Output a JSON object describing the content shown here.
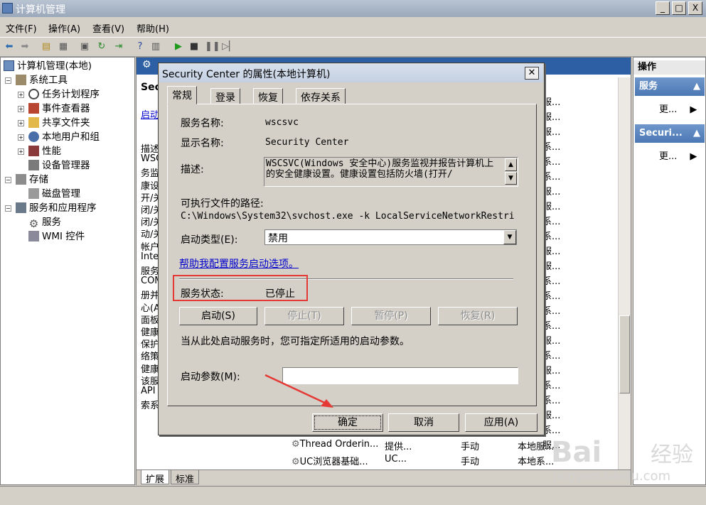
{
  "window": {
    "title": "计算机管理",
    "controls": {
      "minimize": "_",
      "maximize": "□",
      "close": "X"
    }
  },
  "menu": {
    "items": [
      "文件(F)",
      "操作(A)",
      "查看(V)",
      "帮助(H)"
    ]
  },
  "tree": {
    "root": "计算机管理(本地)",
    "items": [
      {
        "label": "系统工具",
        "icon": "tools-icon",
        "expander": "⊟"
      },
      {
        "label": "任务计划程序",
        "icon": "clock-icon",
        "expander": "⊞"
      },
      {
        "label": "事件查看器",
        "icon": "event-viewer-icon",
        "expander": "⊞"
      },
      {
        "label": "共享文件夹",
        "icon": "shared-folder-icon",
        "expander": "⊞"
      },
      {
        "label": "本地用户和组",
        "icon": "users-icon",
        "expander": "⊞"
      },
      {
        "label": "性能",
        "icon": "performance-icon",
        "expander": "⊞"
      },
      {
        "label": "设备管理器",
        "icon": "device-manager-icon",
        "expander": ""
      },
      {
        "label": "存储",
        "icon": "storage-icon",
        "expander": "⊟"
      },
      {
        "label": "磁盘管理",
        "icon": "disk-icon",
        "expander": ""
      },
      {
        "label": "服务和应用程序",
        "icon": "services-apps-icon",
        "expander": "⊟"
      },
      {
        "label": "服务",
        "icon": "gear-icon",
        "expander": ""
      },
      {
        "label": "WMI 控件",
        "icon": "wmi-icon",
        "expander": ""
      }
    ]
  },
  "middle": {
    "title_fragment": "Sec",
    "link_fragment": "启动",
    "desc_fragments": [
      "描述",
      "WSC",
      "务监",
      "康设",
      "开/关",
      "闭/关",
      "闭/关",
      "动/关",
      "帐户",
      "Inte",
      "服务",
      "COM",
      "册并",
      "心(A",
      "面板",
      "健康",
      "保护",
      "络策",
      "健康",
      "该服",
      "API",
      "索系"
    ],
    "rows": [
      {
        "name": "Thread Orderin...",
        "desc": "提供...",
        "startup": "手动",
        "logon": "本地服..."
      },
      {
        "name": "UC浏览器基础...",
        "desc": "UC...",
        "startup": "手动",
        "logon": "本地系..."
      }
    ],
    "right_fragments": [
      "服...",
      "服...",
      "服...",
      "系...",
      "系...",
      "系...",
      "服...",
      "服...",
      "系...",
      "系...",
      "服...",
      "服...",
      "系...",
      "系...",
      "系...",
      "系...",
      "服...",
      "系...",
      "服...",
      "系...",
      "系...",
      "服...",
      "系...",
      "服..."
    ],
    "bottom_tabs": [
      "扩展",
      "标准"
    ]
  },
  "actions": {
    "header": "操作",
    "group1": "服务",
    "group1_more": "更...",
    "group2": "Securi...",
    "group2_more": "更..."
  },
  "dialog": {
    "title": "Security Center 的属性(本地计算机)",
    "tabs": [
      "常规",
      "登录",
      "恢复",
      "依存关系"
    ],
    "service_name_label": "服务名称:",
    "service_name": "wscsvc",
    "display_name_label": "显示名称:",
    "display_name": "Security Center",
    "description_label": "描述:",
    "description": "WSCSVC(Windows 安全中心)服务监视并报告计算机上的安全健康设置。健康设置包括防火墙(打开/",
    "exe_path_label": "可执行文件的路径:",
    "exe_path": "C:\\Windows\\System32\\svchost.exe -k LocalServiceNetworkRestri",
    "startup_type_label": "启动类型(E):",
    "startup_type": "禁用",
    "help_link": "帮助我配置服务启动选项。",
    "status_label": "服务状态:",
    "status_value": "已停止",
    "buttons": {
      "start": "启动(S)",
      "stop": "停止(T)",
      "pause": "暂停(P)",
      "resume": "恢复(R)"
    },
    "start_hint": "当从此处启动服务时，您可指定所适用的启动参数。",
    "params_label": "启动参数(M):",
    "params_value": "",
    "footer": {
      "ok": "确定",
      "cancel": "取消",
      "apply": "应用(A)"
    }
  },
  "watermark": {
    "brand": "Bai",
    "brand2": "经验",
    "url": "jingyan.baidu.com"
  },
  "colors": {
    "highlight_box": "#e53935",
    "link": "#0000cc",
    "header_blue": "#2c5fa3"
  }
}
